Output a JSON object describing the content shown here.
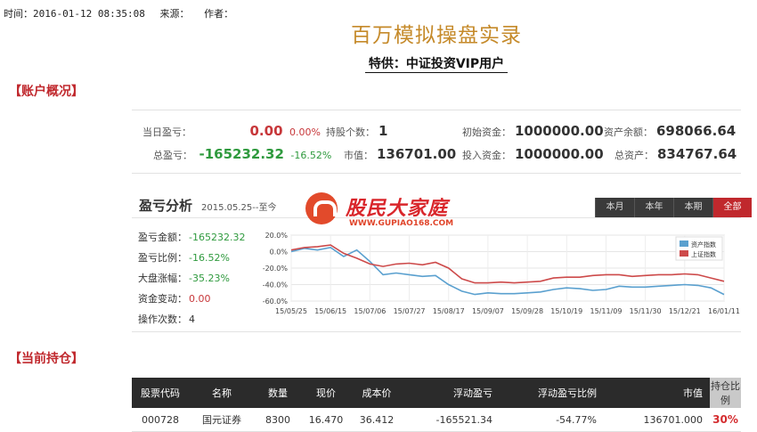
{
  "meta": {
    "time_label": "时间：2016-01-12 08:35:08",
    "source_label": "来源：",
    "author_label": "作者："
  },
  "title": "百万模拟操盘实录",
  "subtitle": "特供：中证投资VIP用户",
  "sections": {
    "overview": "【账户概况】",
    "holdings": "【当前持仓】"
  },
  "overview": {
    "today_pnl": {
      "label": "当日盈亏：",
      "value": "0.00",
      "pct": "0.00%"
    },
    "total_pnl": {
      "label": "总盈亏：",
      "value": "-165232.32",
      "pct": "-16.52%"
    },
    "positions": {
      "label": "持股个数：",
      "value": "1"
    },
    "market_value": {
      "label": "市值：",
      "value": "136701.00"
    },
    "initial_capital": {
      "label": "初始资金：",
      "value": "1000000.00"
    },
    "invested_capital": {
      "label": "投入资金：",
      "value": "1000000.00"
    },
    "balance": {
      "label": "资产余额：",
      "value": "698066.64"
    },
    "total_assets": {
      "label": "总资产：",
      "value": "834767.64"
    }
  },
  "analysis": {
    "title": "盈亏分析",
    "date_range": "2015.05.25--至今",
    "tabs": [
      {
        "label": "本月",
        "active": false
      },
      {
        "label": "本年",
        "active": false
      },
      {
        "label": "本期",
        "active": false
      },
      {
        "label": "全部",
        "active": true
      }
    ],
    "stats": [
      {
        "label": "盈亏金额：",
        "value": "-165232.32",
        "color": "#2f9a3e"
      },
      {
        "label": "盈亏比例：",
        "value": "-16.52%",
        "color": "#2f9a3e"
      },
      {
        "label": "大盘涨幅：",
        "value": "-35.23%",
        "color": "#2f9a3e"
      },
      {
        "label": "资金变动：",
        "value": "0.00",
        "color": "#c7373a"
      },
      {
        "label": "操作次数：",
        "value": "4",
        "color": "#333333"
      }
    ]
  },
  "logo": {
    "text": "股民大家庭",
    "url": "WWW.GUPIAO168.COM"
  },
  "chart_data": {
    "type": "line",
    "x": [
      "15/05/25",
      "15/06/01",
      "15/06/08",
      "15/06/15",
      "15/06/22",
      "15/06/29",
      "15/07/06",
      "15/07/13",
      "15/07/20",
      "15/07/27",
      "15/08/03",
      "15/08/10",
      "15/08/17",
      "15/08/24",
      "15/08/31",
      "15/09/07",
      "15/09/14",
      "15/09/21",
      "15/09/28",
      "15/10/05",
      "15/10/12",
      "15/10/19",
      "15/10/26",
      "15/11/02",
      "15/11/09",
      "15/11/16",
      "15/11/23",
      "15/11/30",
      "15/12/07",
      "15/12/14",
      "15/12/21",
      "15/12/28",
      "16/01/04",
      "16/01/11"
    ],
    "xticks": [
      "15/05/25",
      "15/06/15",
      "15/07/06",
      "15/07/27",
      "15/08/17",
      "15/09/07",
      "15/09/28",
      "15/10/19",
      "15/11/09",
      "15/11/30",
      "15/12/21",
      "16/01/11"
    ],
    "yticks": [
      "20.0%",
      "0.0%",
      "-20.0%",
      "-40.0%",
      "-60.0%"
    ],
    "ylim": [
      -60,
      20
    ],
    "series": [
      {
        "name": "资产指数",
        "color": "#5aa0cf",
        "values": [
          0,
          4,
          2,
          5,
          -6,
          2,
          -12,
          -28,
          -26,
          -28,
          -30,
          -29,
          -40,
          -48,
          -52,
          -50,
          -51,
          -51,
          -50,
          -49,
          -46,
          -44,
          -45,
          -47,
          -46,
          -42,
          -43,
          -43,
          -42,
          -41,
          -40,
          -41,
          -44,
          -52
        ]
      },
      {
        "name": "上证指数",
        "color": "#cd4a4a",
        "values": [
          2,
          5,
          6,
          8,
          -2,
          -8,
          -15,
          -18,
          -15,
          -14,
          -16,
          -13,
          -20,
          -33,
          -38,
          -38,
          -37,
          -38,
          -37,
          -36,
          -32,
          -31,
          -31,
          -29,
          -28,
          -28,
          -30,
          -29,
          -28,
          -28,
          -27,
          -28,
          -32,
          -36
        ]
      }
    ]
  },
  "holdings": {
    "headers": [
      "股票代码",
      "名称",
      "数量",
      "现价",
      "成本价",
      "浮动盈亏",
      "浮动盈亏比例",
      "市值",
      "持仓比例"
    ],
    "rows": [
      {
        "code": "000728",
        "name": "国元证券",
        "qty": "8300",
        "price": "16.470",
        "cost": "36.412",
        "pnl": "-165521.34",
        "pnl_pct": "-54.77%",
        "value": "136701.000",
        "ratio": "30%"
      }
    ]
  }
}
